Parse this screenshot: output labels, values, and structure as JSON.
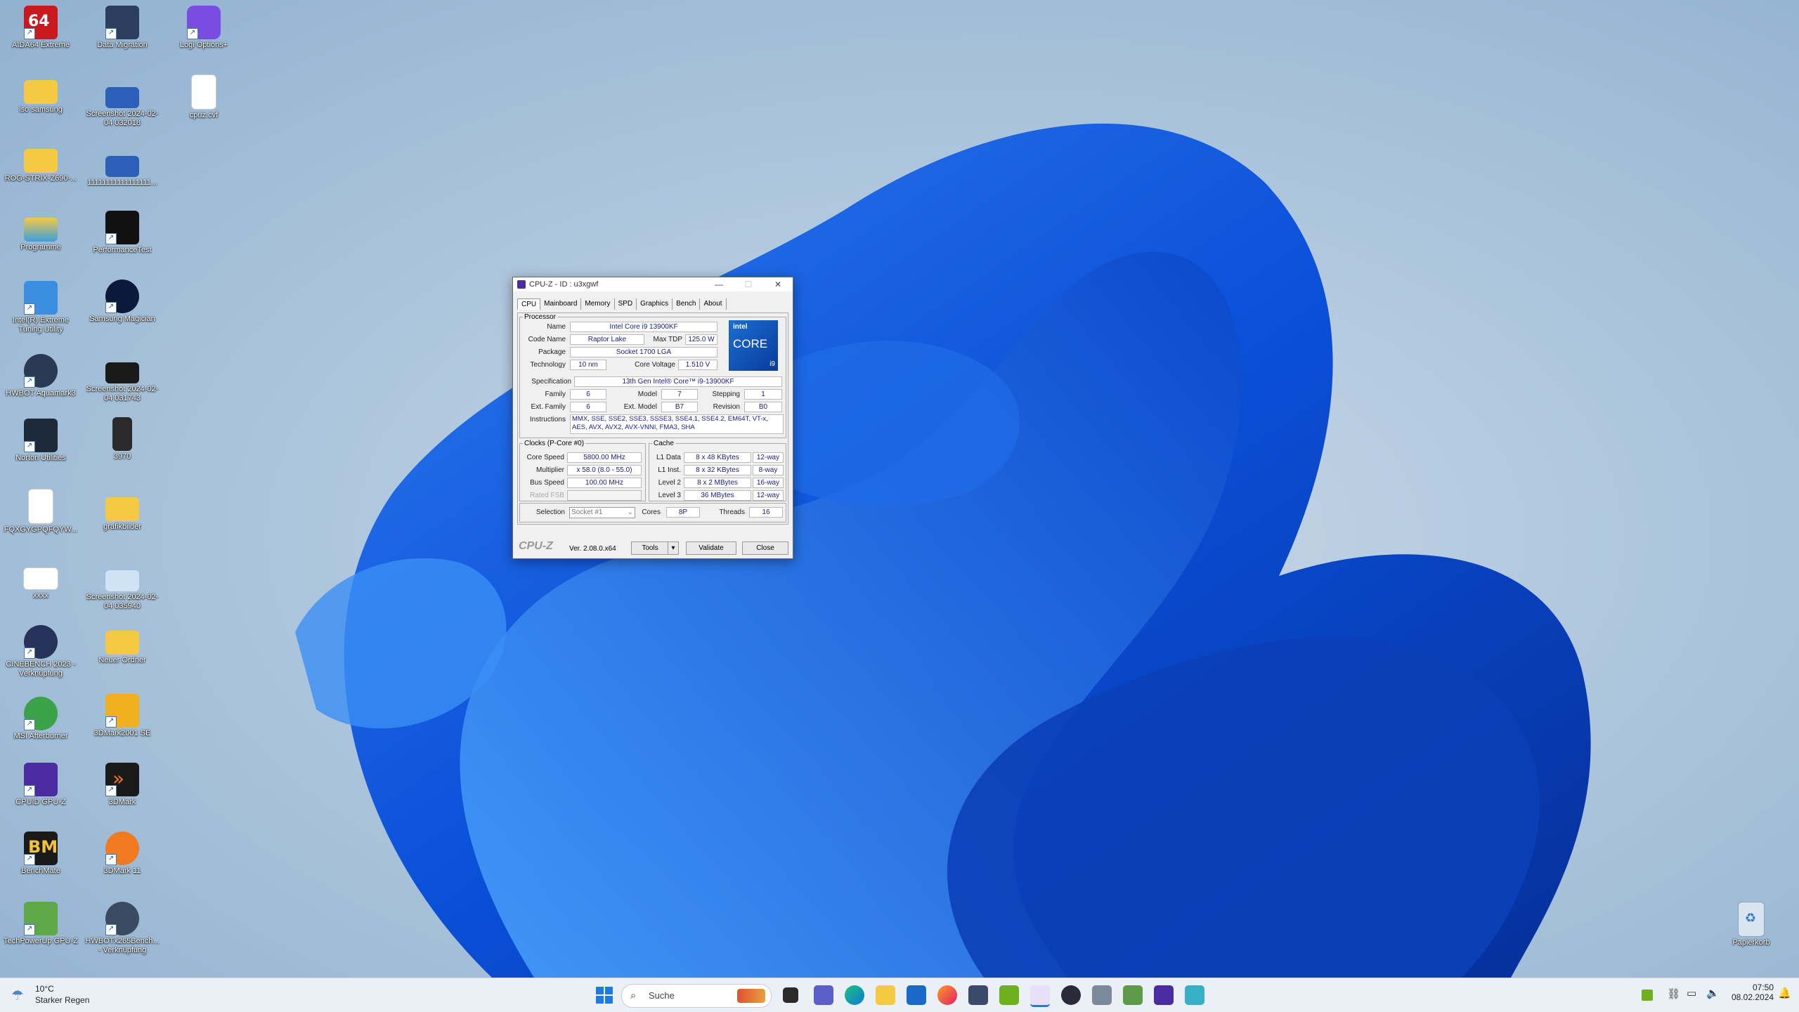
{
  "desktop": {
    "icons_col1": [
      "AIDA64 Extreme",
      "iso samsung",
      "ROG-STRIX-Z690-...",
      "Programme",
      "Intel(R) Extreme Tuning Utility",
      "HWBOT Aquamark3",
      "Norton Utilities",
      "FQXGYGPQFQYW...",
      "xxxx",
      "CINEBENCH 2023 - Verknüpfung",
      "MSI Afterburner",
      "CPUID GPU-Z",
      "BenchMate",
      "TechPowerUp GPU-Z"
    ],
    "icons_col2": [
      "Data Migration",
      "Screenshot 2024-02-04 032018",
      "11111111111111111...",
      "PerformanceTest",
      "Samsung Magician",
      "Screenshot 2024-02-04 031743",
      "3970",
      "grafikbilder",
      "Screenshot 2024-02-04 035940",
      "Neuer Ordner",
      "3DMark2001 SE",
      "3DMark",
      "3DMark 11",
      "HWBOTx265Bench... - Verknüpfung"
    ],
    "icons_col3": [
      "Logi Options+",
      "cpuz.cvf"
    ],
    "recycle_bin": "Papierkorb"
  },
  "cpuz": {
    "title": "CPU-Z  -  ID : u3xgwf",
    "tabs": [
      "CPU",
      "Mainboard",
      "Memory",
      "SPD",
      "Graphics",
      "Bench",
      "About"
    ],
    "processor_label": "Processor",
    "name_label": "Name",
    "name": "Intel Core i9 13900KF",
    "codename_label": "Code Name",
    "codename": "Raptor Lake",
    "maxtdp_label": "Max TDP",
    "maxtdp": "125.0 W",
    "package_label": "Package",
    "package": "Socket 1700 LGA",
    "technology_label": "Technology",
    "technology": "10 nm",
    "corevoltage_label": "Core Voltage",
    "corevoltage": "1.510 V",
    "spec_label": "Specification",
    "spec": "13th Gen Intel® Core™ i9-13900KF",
    "family_label": "Family",
    "family": "6",
    "model_label": "Model",
    "model": "7",
    "stepping_label": "Stepping",
    "stepping": "1",
    "extfamily_label": "Ext. Family",
    "extfamily": "6",
    "extmodel_label": "Ext. Model",
    "extmodel": "B7",
    "revision_label": "Revision",
    "revision": "B0",
    "instructions_label": "Instructions",
    "instructions": "MMX, SSE, SSE2, SSE3, SSSE3, SSE4.1, SSE4.2, EM64T, VT-x, AES, AVX, AVX2, AVX-VNNI, FMA3, SHA",
    "logo_brand": "intel",
    "logo_core": "CORE",
    "logo_tier": "i9",
    "clocks_label": "Clocks (P-Core #0)",
    "corespeed_label": "Core Speed",
    "corespeed": "5800.00 MHz",
    "multiplier_label": "Multiplier",
    "multiplier": "x 58.0 (8.0 - 55.0)",
    "busspeed_label": "Bus Speed",
    "busspeed": "100.00 MHz",
    "ratedfsb_label": "Rated FSB",
    "cache_label": "Cache",
    "l1data_label": "L1 Data",
    "l1data": "8 x 48 KBytes",
    "l1data_way": "12-way",
    "l1inst_label": "L1 Inst.",
    "l1inst": "8 x 32 KBytes",
    "l1inst_way": "8-way",
    "l2_label": "Level 2",
    "l2": "8 x 2 MBytes",
    "l2_way": "16-way",
    "l3_label": "Level 3",
    "l3": "36 MBytes",
    "l3_way": "12-way",
    "selection_label": "Selection",
    "selection": "Socket #1",
    "cores_label": "Cores",
    "cores": "8P",
    "threads_label": "Threads",
    "threads": "16",
    "brand": "CPU-Z",
    "version": "Ver. 2.08.0.x64",
    "tools": "Tools",
    "validate": "Validate",
    "close": "Close"
  },
  "taskbar": {
    "weather_temp": "10°C",
    "weather_desc": "Starker Regen",
    "search_placeholder": "Suche",
    "time": "07:50",
    "date": "08.02.2024"
  }
}
